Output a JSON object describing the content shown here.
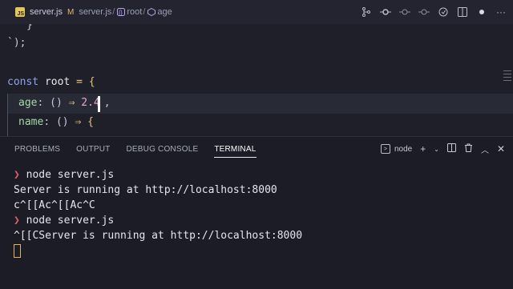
{
  "breadcrumb": {
    "file_badge": "JS",
    "filename": "server.js",
    "modified": "M",
    "path_file": "server.js",
    "path_obj": "root",
    "path_prop": "age"
  },
  "toolbar": {
    "icons": [
      "source-control-icon",
      "git-commit-icon",
      "timeline-icon",
      "compare-icon",
      "go-live-icon",
      "split-editor-icon",
      "unsaved-dot-icon",
      "more-icon"
    ]
  },
  "editor": {
    "lines": {
      "l1": "}",
      "l2": "`);",
      "l4_kw": "const",
      "l4_var": "root",
      "l4_op": "=",
      "l4_brace": "{",
      "l5_prop": "age",
      "l5_colon": ":",
      "l5_parens": "()",
      "l5_arrow": "⇒",
      "l5_num": "2.4",
      "l5_comma": ",",
      "l6_prop": "name",
      "l6_colon": ":",
      "l6_parens": "()",
      "l6_arrow": "⇒",
      "l6_brace": "{"
    }
  },
  "panel": {
    "tabs": [
      "PROBLEMS",
      "OUTPUT",
      "DEBUG CONSOLE",
      "TERMINAL"
    ],
    "active_tab": "TERMINAL",
    "terminal_name": "node",
    "terminal": {
      "prompt": "❯",
      "cmd1": "node server.js",
      "out1": "Server is running at http://localhost:8000",
      "out2": "c^[[Ac^[[Ac^C",
      "cmd2": "node server.js",
      "out3": "^[[CServer is running at http://localhost:8000"
    }
  },
  "colors": {
    "background": "#1e1f29",
    "prompt": "#e05f6f",
    "keyword": "#8fa4e8",
    "property": "#a8d6a8",
    "number": "#e9a8d2",
    "brace": "#e5c07b"
  }
}
